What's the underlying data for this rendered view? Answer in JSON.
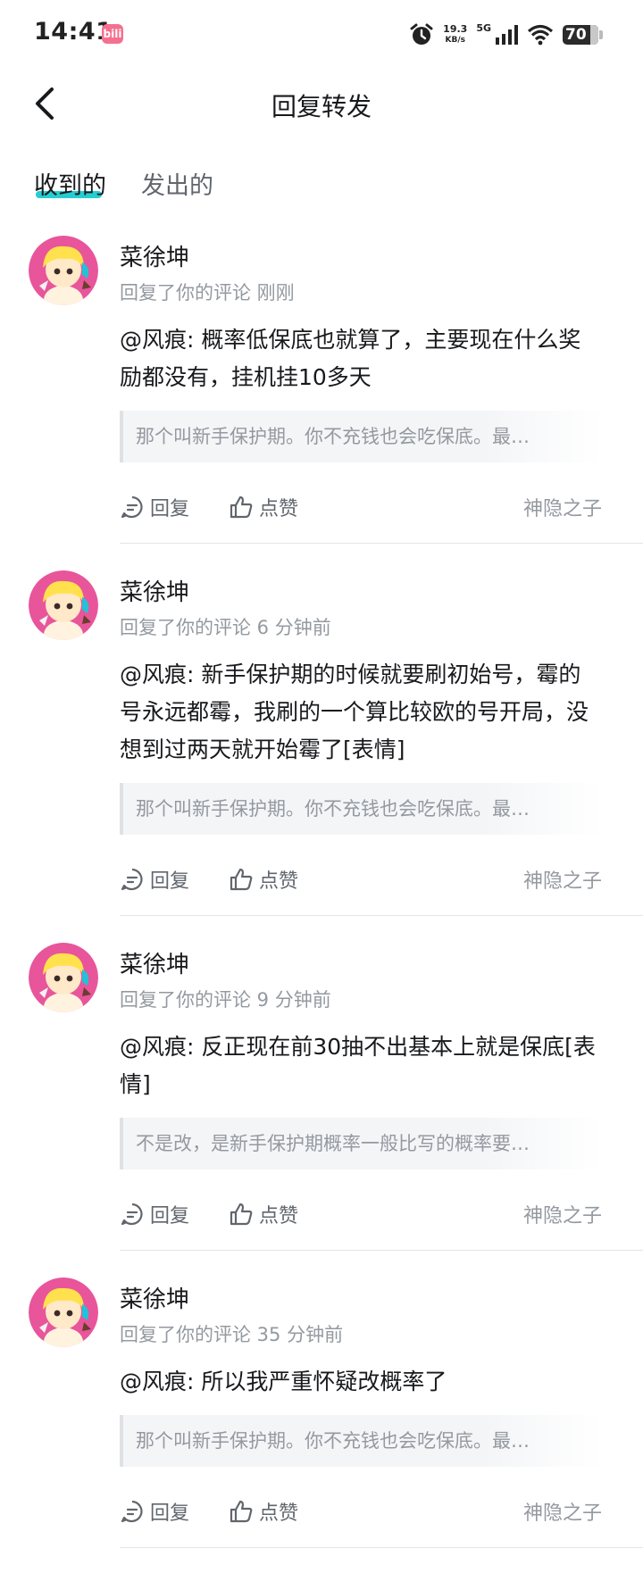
{
  "status_bar": {
    "time": "14:41",
    "app_badge": "bili",
    "net_speed": "19.3",
    "net_unit": "KB/s",
    "network": "5G",
    "battery": "70",
    "icons": [
      "alarm-icon",
      "signal-icon",
      "wifi-icon",
      "battery-icon"
    ]
  },
  "header": {
    "title": "回复转发",
    "back_icon": "chevron-left-icon"
  },
  "tabs": [
    {
      "label": "收到的",
      "active": true
    },
    {
      "label": "发出的",
      "active": false
    }
  ],
  "accent": "#00c4c8",
  "items": [
    {
      "name": "菜徐坤",
      "meta": "回复了你的评论 刚刚",
      "body": "@风痕: 概率低保底也就算了，主要现在什么奖励都没有，挂机挂10多天",
      "quote": "那个叫新手保护期。你不充钱也会吃保底。最…",
      "reply": "回复",
      "like": "点赞",
      "source": "神隐之子"
    },
    {
      "name": "菜徐坤",
      "meta": "回复了你的评论 6 分钟前",
      "body": "@风痕: 新手保护期的时候就要刷初始号，霉的号永远都霉，我刷的一个算比较欧的号开局，没想到过两天就开始霉了[表情]",
      "quote": "那个叫新手保护期。你不充钱也会吃保底。最…",
      "reply": "回复",
      "like": "点赞",
      "source": "神隐之子"
    },
    {
      "name": "菜徐坤",
      "meta": "回复了你的评论 9 分钟前",
      "body": "@风痕: 反正现在前30抽不出基本上就是保底[表情]",
      "quote": "不是改，是新手保护期概率一般比写的概率要…",
      "reply": "回复",
      "like": "点赞",
      "source": "神隐之子"
    },
    {
      "name": "菜徐坤",
      "meta": "回复了你的评论 35 分钟前",
      "body": "@风痕: 所以我严重怀疑改概率了",
      "quote": "那个叫新手保护期。你不充钱也会吃保底。最…",
      "reply": "回复",
      "like": "点赞",
      "source": "神隐之子"
    }
  ]
}
